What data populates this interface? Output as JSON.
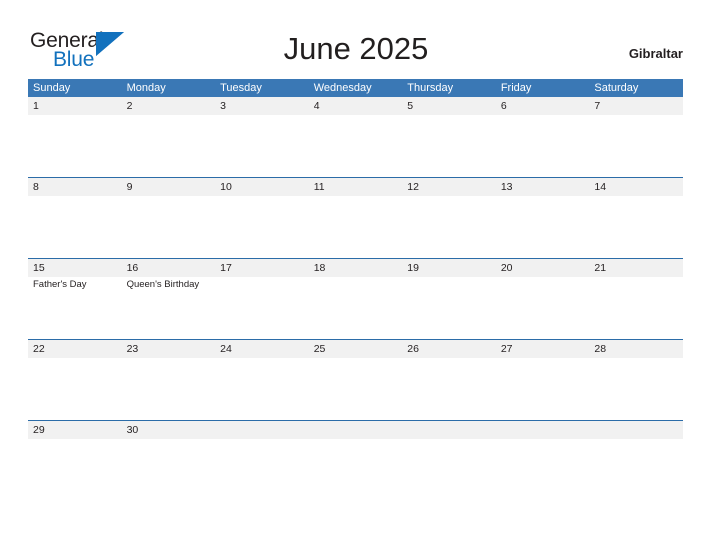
{
  "header": {
    "logo": {
      "text_primary": "General",
      "text_secondary": "Blue",
      "flag_icon": "triangle-flag-icon",
      "primary_color": "#231f20",
      "secondary_color": "#1271bd"
    },
    "title": "June 2025",
    "region": "Gibraltar"
  },
  "calendar": {
    "header_color": "#3a78b5",
    "band_color": "#f1f1f1",
    "divider_color": "#2b6ca8",
    "weekdays": [
      "Sunday",
      "Monday",
      "Tuesday",
      "Wednesday",
      "Thursday",
      "Friday",
      "Saturday"
    ],
    "weeks": [
      {
        "days": [
          {
            "number": "1",
            "event": ""
          },
          {
            "number": "2",
            "event": ""
          },
          {
            "number": "3",
            "event": ""
          },
          {
            "number": "4",
            "event": ""
          },
          {
            "number": "5",
            "event": ""
          },
          {
            "number": "6",
            "event": ""
          },
          {
            "number": "7",
            "event": ""
          }
        ]
      },
      {
        "days": [
          {
            "number": "8",
            "event": ""
          },
          {
            "number": "9",
            "event": ""
          },
          {
            "number": "10",
            "event": ""
          },
          {
            "number": "11",
            "event": ""
          },
          {
            "number": "12",
            "event": ""
          },
          {
            "number": "13",
            "event": ""
          },
          {
            "number": "14",
            "event": ""
          }
        ]
      },
      {
        "days": [
          {
            "number": "15",
            "event": "Father's Day"
          },
          {
            "number": "16",
            "event": "Queen's Birthday"
          },
          {
            "number": "17",
            "event": ""
          },
          {
            "number": "18",
            "event": ""
          },
          {
            "number": "19",
            "event": ""
          },
          {
            "number": "20",
            "event": ""
          },
          {
            "number": "21",
            "event": ""
          }
        ]
      },
      {
        "days": [
          {
            "number": "22",
            "event": ""
          },
          {
            "number": "23",
            "event": ""
          },
          {
            "number": "24",
            "event": ""
          },
          {
            "number": "25",
            "event": ""
          },
          {
            "number": "26",
            "event": ""
          },
          {
            "number": "27",
            "event": ""
          },
          {
            "number": "28",
            "event": ""
          }
        ]
      },
      {
        "days": [
          {
            "number": "29",
            "event": ""
          },
          {
            "number": "30",
            "event": ""
          },
          {
            "number": "",
            "event": ""
          },
          {
            "number": "",
            "event": ""
          },
          {
            "number": "",
            "event": ""
          },
          {
            "number": "",
            "event": ""
          },
          {
            "number": "",
            "event": ""
          }
        ]
      }
    ]
  }
}
